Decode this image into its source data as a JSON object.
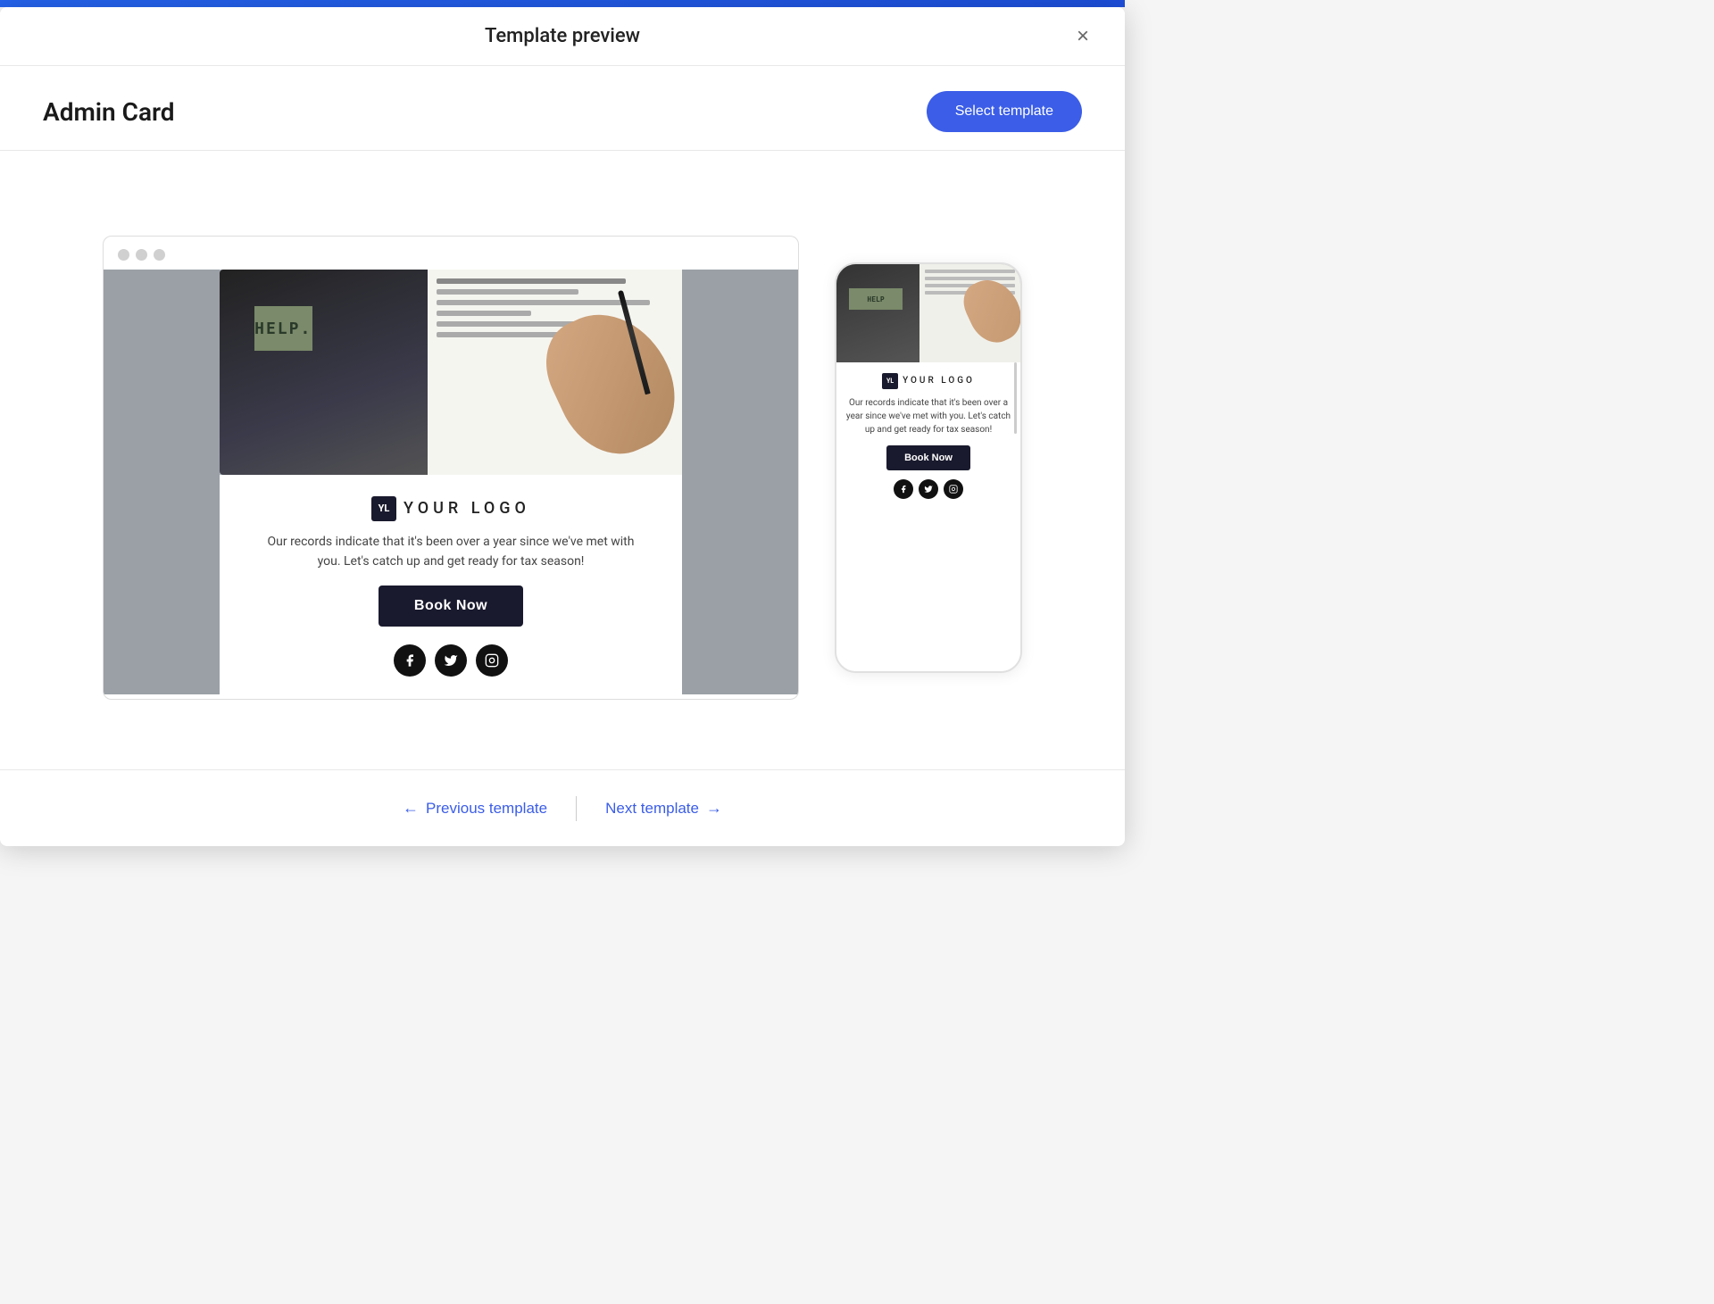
{
  "modal": {
    "title": "Template preview",
    "close_label": "×"
  },
  "subheader": {
    "template_name": "Admin Card",
    "select_button_label": "Select template"
  },
  "desktop_preview": {
    "dots": [
      "dot1",
      "dot2",
      "dot3"
    ]
  },
  "email_content": {
    "logo_badge": "YL",
    "logo_text": "YOUR LOGO",
    "body_text": "Our records indicate that it's been over a year since we've met with you. Let's catch up and get ready for tax season!",
    "book_button_label": "Book Now"
  },
  "mobile_preview": {
    "logo_badge": "YL",
    "logo_text": "YOUR LOGO",
    "body_text": "Our records indicate that it's been over a year since we've met with you. Let's catch up and get ready for tax season!",
    "book_button_label": "Book Now"
  },
  "footer": {
    "previous_label": "Previous template",
    "next_label": "Next template",
    "arrow_left": "←",
    "arrow_right": "→"
  },
  "social": {
    "facebook": "f",
    "twitter": "t",
    "instagram": "◻"
  }
}
